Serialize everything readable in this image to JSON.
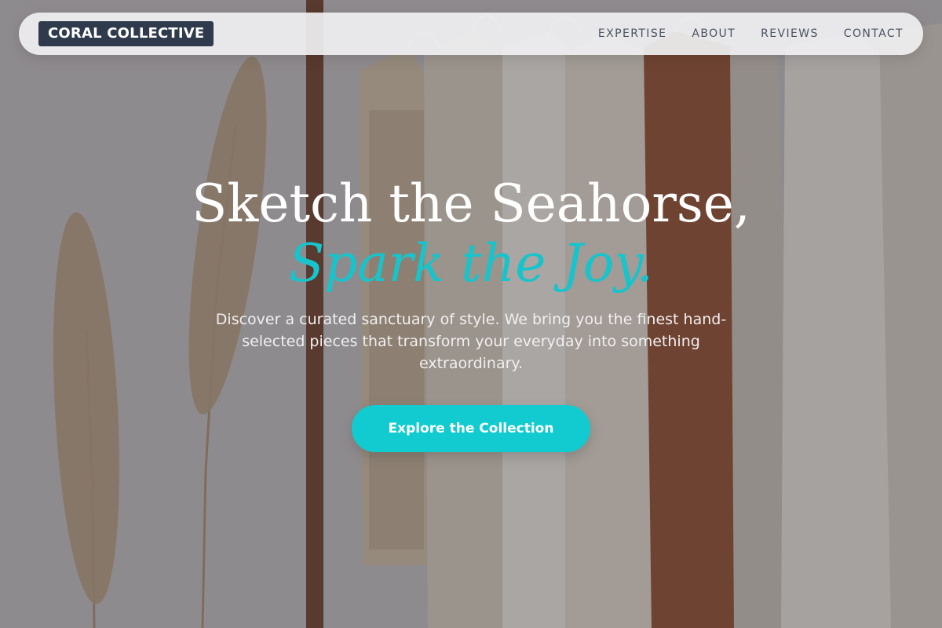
{
  "brand": {
    "logo_text": "CORAL COLLECTIVE"
  },
  "nav": {
    "items": [
      {
        "label": "EXPERTISE"
      },
      {
        "label": "ABOUT"
      },
      {
        "label": "REVIEWS"
      },
      {
        "label": "CONTACT"
      }
    ]
  },
  "hero": {
    "headline_line1": "Sketch the Seahorse,",
    "headline_line2": "Spark the Joy.",
    "subtext": "Discover a curated sanctuary of style. We bring you the finest hand-selected pieces that transform your everyday into something extraordinary.",
    "cta_label": "Explore the Collection",
    "background": "clothing-rack-photo"
  },
  "colors": {
    "accent": "#12cbd0",
    "logo_bg": "#2f3a4c",
    "nav_text": "#4a5262",
    "headline": "#ffffff"
  }
}
